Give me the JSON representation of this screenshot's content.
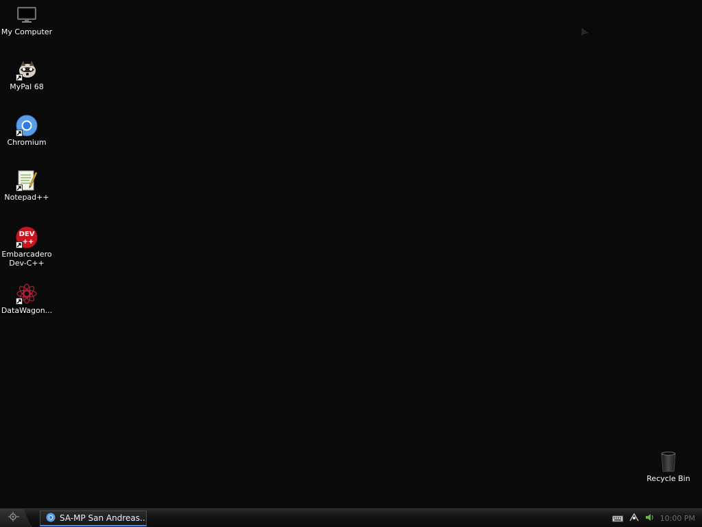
{
  "desktop": {
    "icons": [
      {
        "label": "My Computer"
      },
      {
        "label": "MyPal 68"
      },
      {
        "label": "Chromium"
      },
      {
        "label": "Notepad++"
      },
      {
        "label": "Embarcadero Dev-C++"
      },
      {
        "label": "DataWagon..."
      },
      {
        "label": "Recycle Bin"
      }
    ],
    "devcpp_icon_text": "DEV\n++"
  },
  "taskbar": {
    "task_title": "SA-MP San Andreas...",
    "clock": "10:00 PM"
  },
  "colors": {
    "desktop_bg": "#0a0a0a",
    "task_accent": "#3b8ee8"
  },
  "icons": {
    "start": "start-orb-icon",
    "keyboard": "keyboard-icon",
    "network": "network-icon",
    "volume": "volume-icon"
  }
}
